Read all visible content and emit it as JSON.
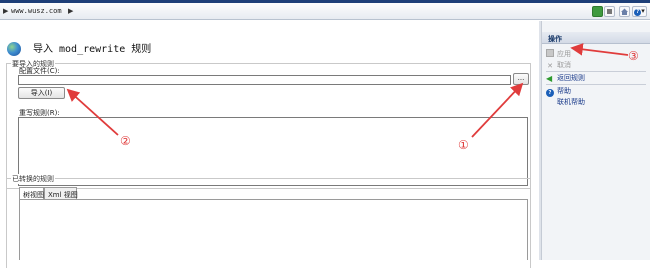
{
  "address_bar": {
    "arrow": "▶",
    "crumb": "www.wusz.com",
    "separator": "▶",
    "help_label": "▾"
  },
  "main": {
    "title": "导入 mod_rewrite 规则",
    "import_group_label": "要导入的规则",
    "config_file_label": "配置文件(C):",
    "config_file_value": "",
    "browse_button": "...",
    "import_button": "导入(I)",
    "rewrite_rules_label": "重写规则(R):",
    "rewrite_rules_value": "",
    "converted_group_label": "已转换的规则",
    "tabs": [
      {
        "label": "树视图"
      },
      {
        "label": "Xml 视图"
      }
    ]
  },
  "actions": {
    "header": "操作",
    "items": [
      {
        "label": "应用",
        "icon": "apply-icon",
        "enabled": false
      },
      {
        "label": "取消",
        "icon": "cancel-icon",
        "enabled": false
      },
      {
        "label": "返回规则",
        "icon": "back-arrow-icon",
        "enabled": true
      },
      {
        "label": "帮助",
        "icon": "help-icon",
        "enabled": true
      },
      {
        "label": "联机帮助",
        "icon": "",
        "enabled": true
      }
    ]
  },
  "annotations": {
    "marker_1": "①",
    "marker_2": "②",
    "marker_3": "③",
    "color": "#e03c3c"
  }
}
